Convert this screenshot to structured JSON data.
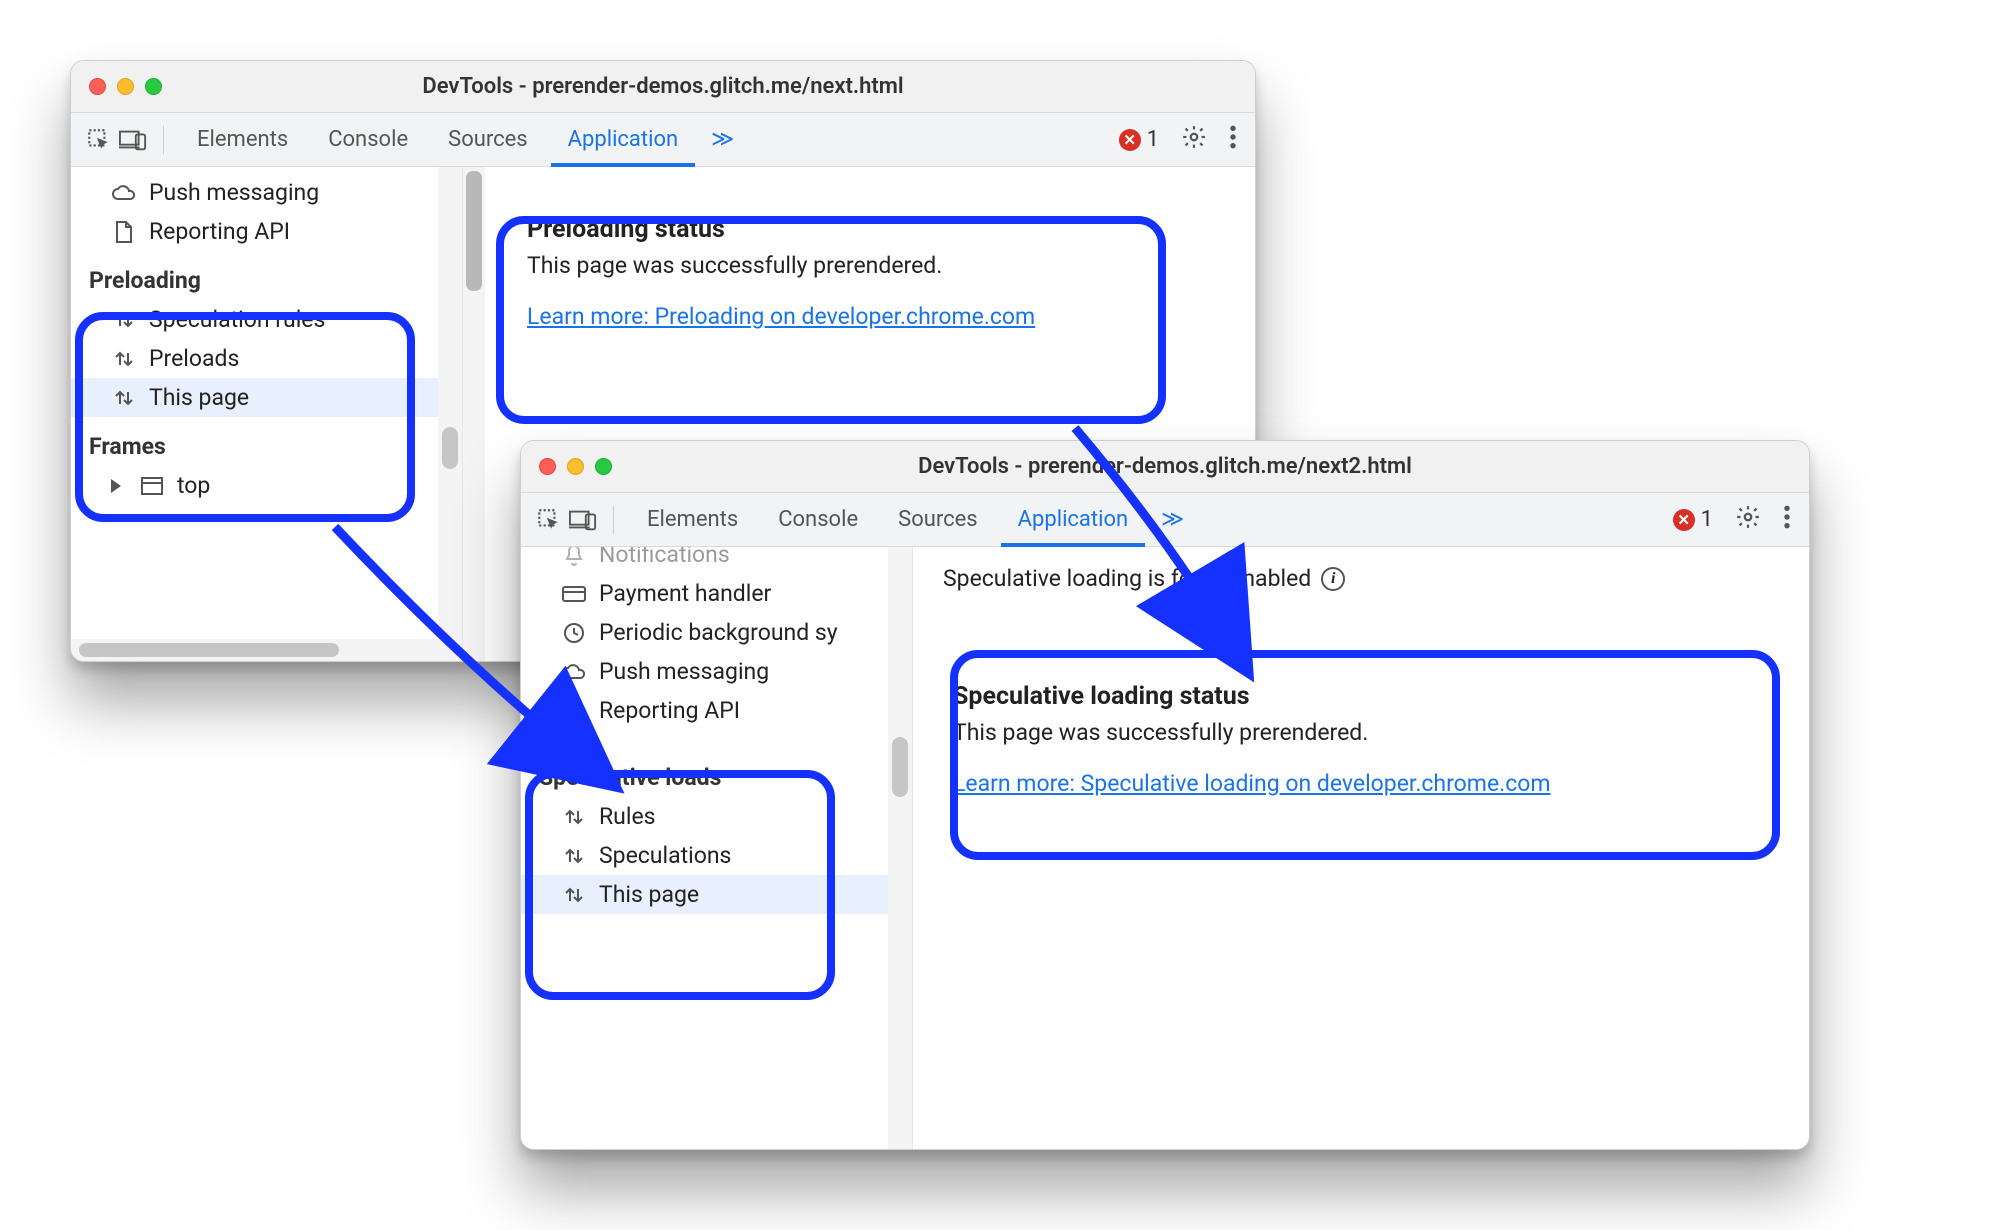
{
  "windows": [
    {
      "id": "w1",
      "title": "DevTools - prerender-demos.glitch.me/next.html",
      "tabs": [
        "Elements",
        "Console",
        "Sources",
        "Application"
      ],
      "active_tab": "Application",
      "error_count": "1",
      "sidebar_upper": [
        {
          "icon": "cloud",
          "label": "Push messaging"
        },
        {
          "icon": "doc",
          "label": "Reporting API"
        }
      ],
      "preloading_title": "Preloading",
      "preloading_items": [
        {
          "icon": "updown",
          "label": "Speculation rules",
          "sel": false
        },
        {
          "icon": "updown",
          "label": "Preloads",
          "sel": false
        },
        {
          "icon": "updown",
          "label": "This page",
          "sel": true
        }
      ],
      "frames_title": "Frames",
      "frames_items": [
        {
          "icon": "window",
          "label": "top"
        }
      ],
      "panel": {
        "heading": "Preloading status",
        "text": "This page was successfully prerendered.",
        "link": "Learn more: Preloading on developer.chrome.com"
      }
    },
    {
      "id": "w2",
      "title": "DevTools - prerender-demos.glitch.me/next2.html",
      "tabs": [
        "Elements",
        "Console",
        "Sources",
        "Application"
      ],
      "active_tab": "Application",
      "error_count": "1",
      "sidebar_upper": [
        {
          "icon": "bell",
          "label": "Notifications"
        },
        {
          "icon": "card",
          "label": "Payment handler"
        },
        {
          "icon": "clock",
          "label": "Periodic background sy"
        },
        {
          "icon": "cloud",
          "label": "Push messaging"
        },
        {
          "icon": "doc",
          "label": "Reporting API"
        }
      ],
      "spec_title": "Speculative loads",
      "spec_items": [
        {
          "icon": "updown",
          "label": "Rules",
          "sel": false
        },
        {
          "icon": "updown",
          "label": "Speculations",
          "sel": false
        },
        {
          "icon": "updown",
          "label": "This page",
          "sel": true
        }
      ],
      "panel": {
        "banner": "Speculative loading is force-enabled",
        "heading": "Speculative loading status",
        "text": "This page was successfully prerendered.",
        "link": "Learn more: Speculative loading on developer.chrome.com"
      }
    }
  ],
  "colors": {
    "accent": "#1a73e8",
    "callout": "#1431ff"
  }
}
